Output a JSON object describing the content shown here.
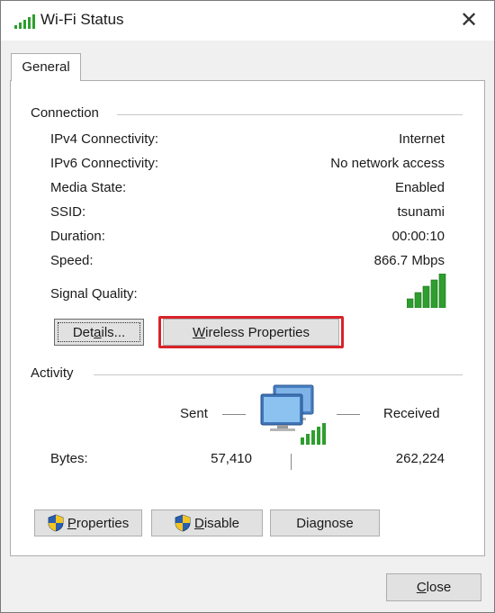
{
  "window": {
    "title": "Wi-Fi Status",
    "close_glyph": "✕"
  },
  "tabs": [
    {
      "label": "General",
      "selected": true
    }
  ],
  "connection": {
    "heading": "Connection",
    "rows": [
      {
        "label": "IPv4 Connectivity:",
        "value": "Internet"
      },
      {
        "label": "IPv6 Connectivity:",
        "value": "No network access"
      },
      {
        "label": "Media State:",
        "value": "Enabled"
      },
      {
        "label": "SSID:",
        "value": "tsunami"
      },
      {
        "label": "Duration:",
        "value": "00:00:10"
      },
      {
        "label": "Speed:",
        "value": "866.7 Mbps"
      }
    ],
    "signal_label": "Signal Quality:",
    "signal_bars": 5,
    "details_button": {
      "before": "Det",
      "accel": "a",
      "after": "ils..."
    },
    "wireless_button": {
      "accel": "W",
      "after": "ireless Properties"
    }
  },
  "activity": {
    "heading": "Activity",
    "sent_label": "Sent",
    "received_label": "Received",
    "bytes_label": "Bytes:",
    "bytes_sent": "57,410",
    "bytes_received": "262,224"
  },
  "bottom_buttons": {
    "properties": {
      "accel": "P",
      "after": "roperties"
    },
    "disable": {
      "accel": "D",
      "after": "isable"
    },
    "diagnose": {
      "before": "Dia",
      "accel": "g",
      "after": "nose"
    }
  },
  "footer": {
    "close": {
      "accel": "C",
      "after": "lose"
    }
  },
  "colors": {
    "accent_highlight": "#d8232a",
    "signal_green": "#2e9e2e"
  },
  "icons": {
    "title": "wifi-signal-icon",
    "signal": "signal-strength-icon",
    "network": "network-computers-icon",
    "shield": "uac-shield-icon"
  }
}
